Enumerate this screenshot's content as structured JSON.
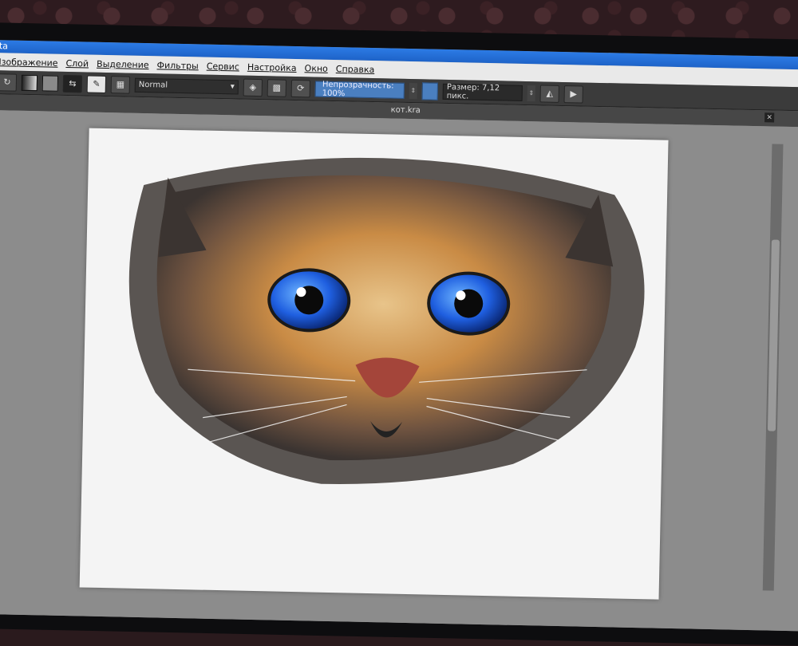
{
  "window": {
    "title": "ita"
  },
  "menu": [
    "Изображение",
    "Слой",
    "Выделение",
    "Фильтры",
    "Сервис",
    "Настройка",
    "Окно",
    "Справка"
  ],
  "toolbar": {
    "blend_mode": "Normal",
    "opacity_label": "Непрозрачность: 100%",
    "size_label": "Размер: 7,12 пикс."
  },
  "document": {
    "tab_title": "кот.kra",
    "close_glyph": "×"
  },
  "colors": {
    "accent": "#2c7be5",
    "toolbar_bg": "#3b3b3b",
    "canvas_bg": "#f4f4f4"
  },
  "icons": [
    "redo-icon",
    "gradient-icon",
    "pattern-icon",
    "swap-colors-icon",
    "brush-preset-icon",
    "grid-icon",
    "eraser-icon",
    "preserve-alpha-icon",
    "reload-icon",
    "mirror-horizontal-icon",
    "mirror-vertical-icon"
  ]
}
